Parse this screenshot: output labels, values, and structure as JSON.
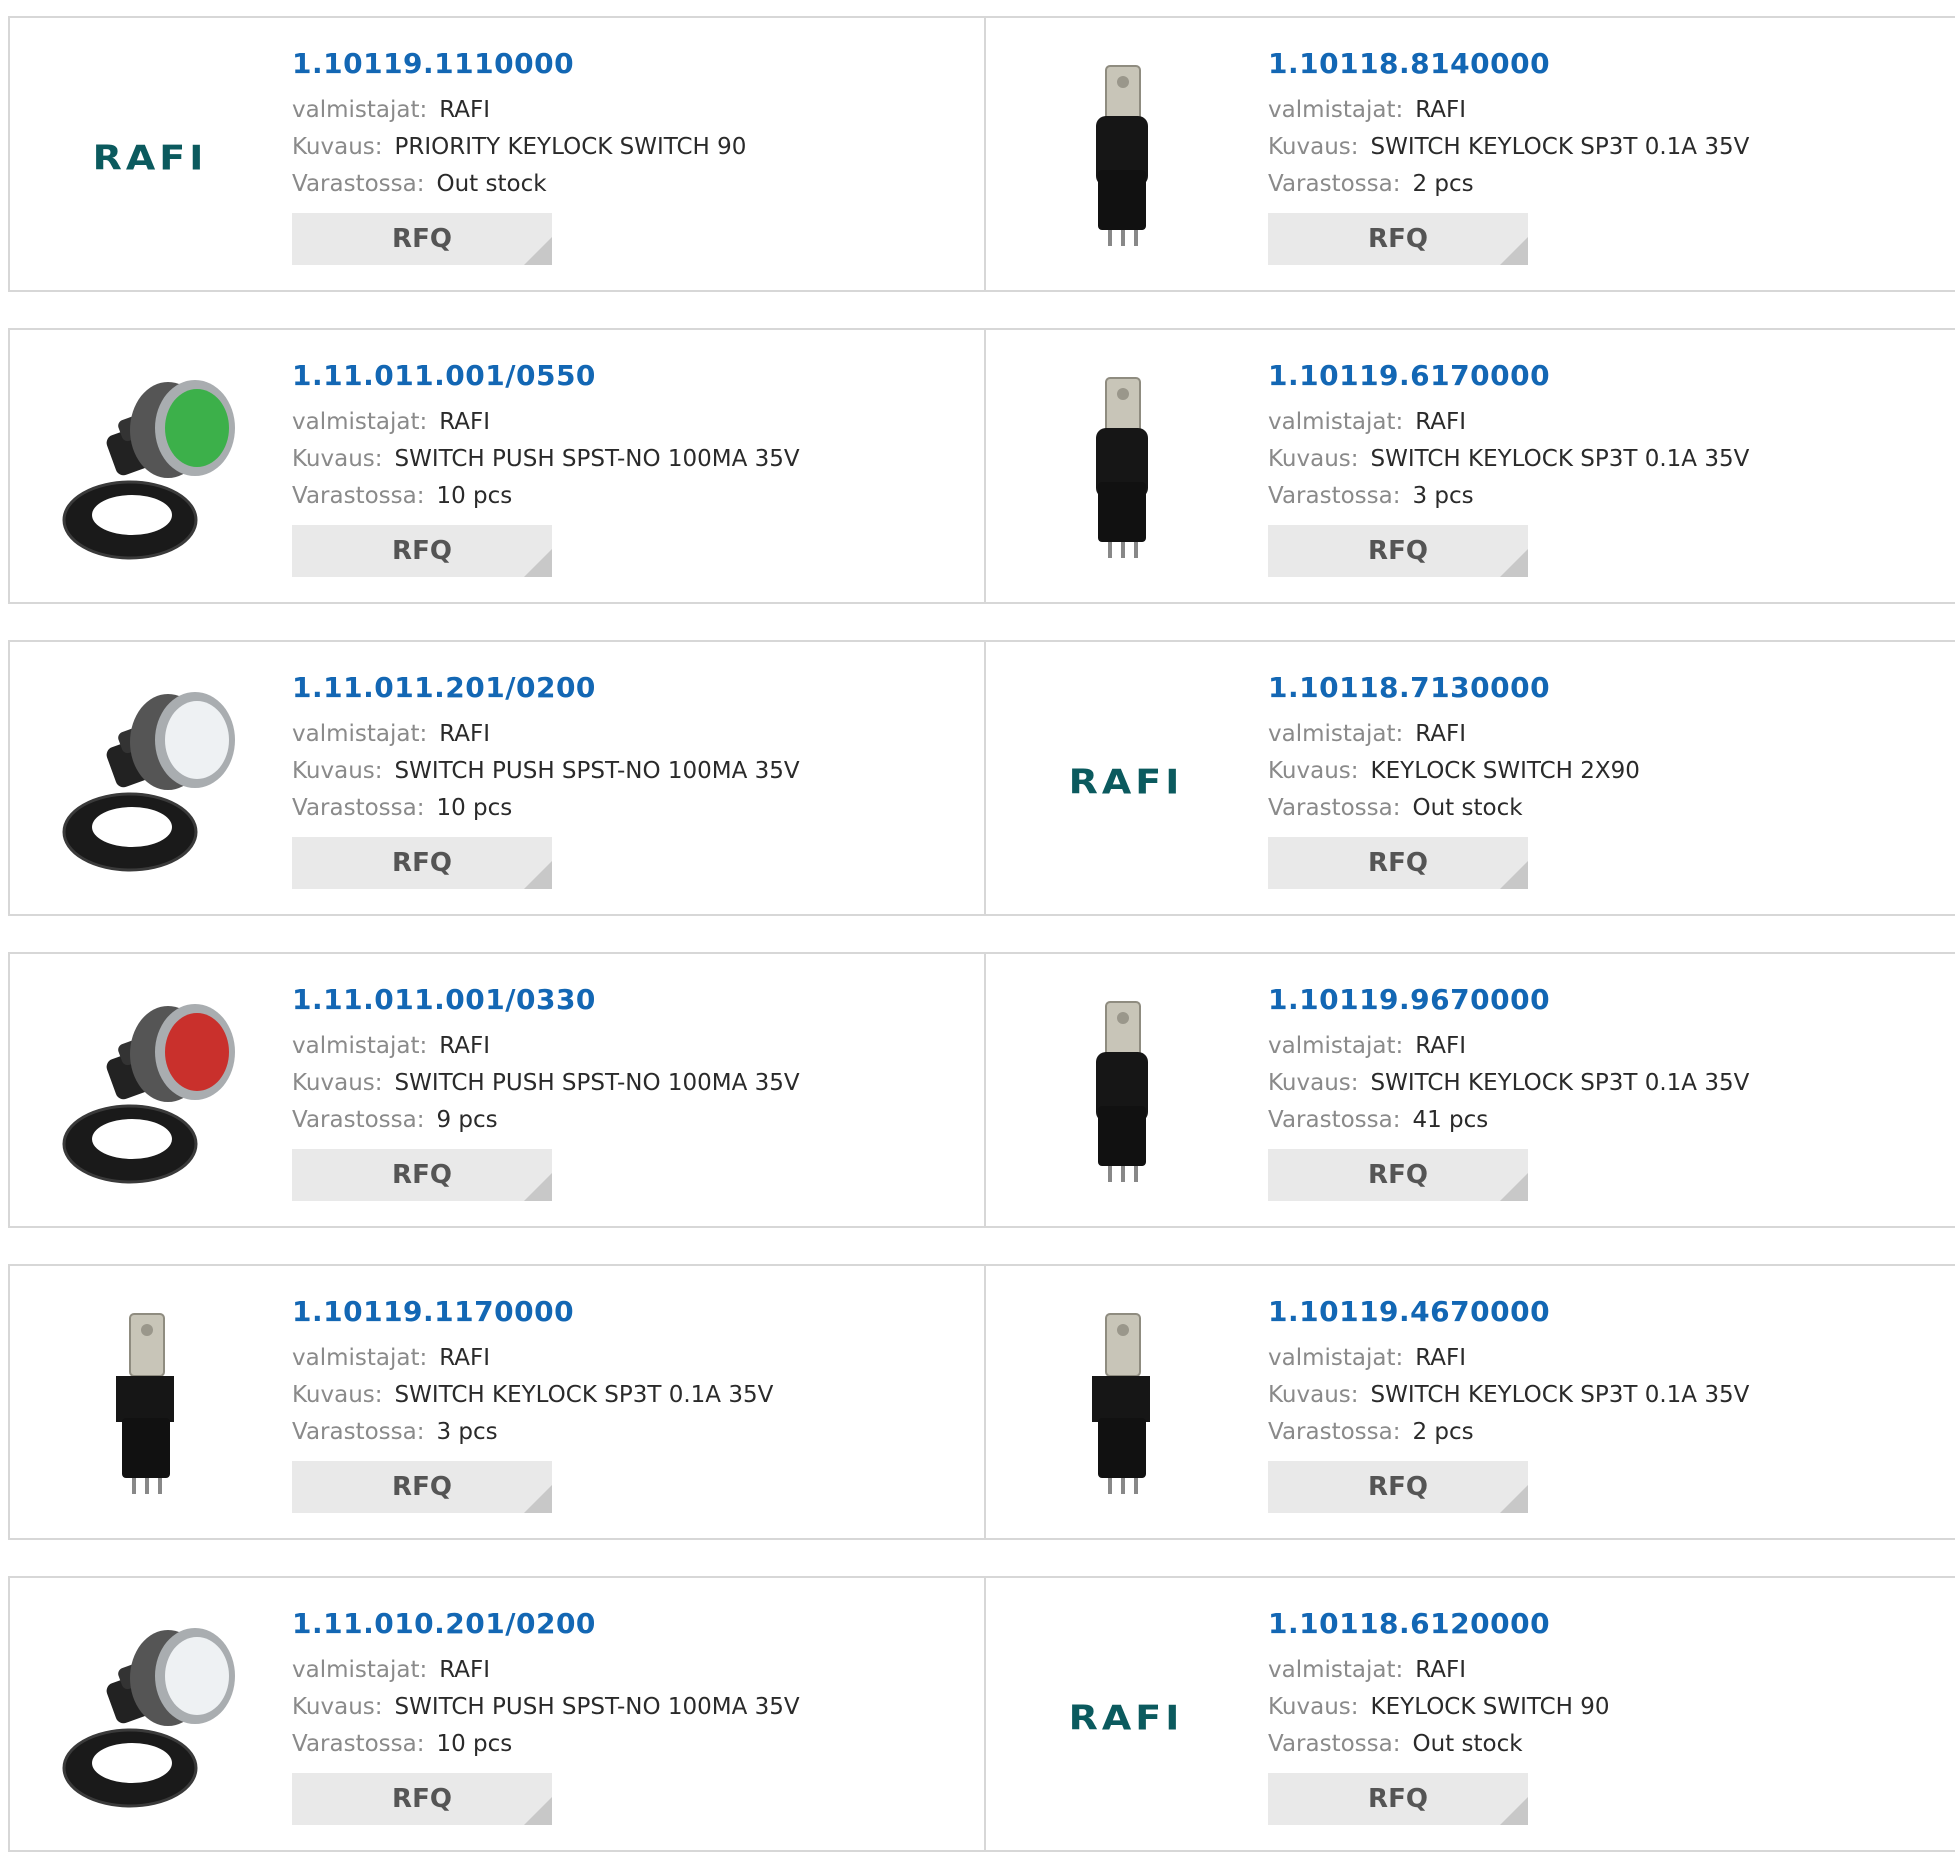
{
  "labels": {
    "manufacturer": "valmistajat:",
    "description": "Kuvaus:",
    "stock": "Varastossa:",
    "rfq": "RFQ"
  },
  "brand_logo_text": "RAFI",
  "colors": {
    "part_number": "#1367b4",
    "rafi_logo": "#0b5a5e",
    "green_button": "#3cb04a",
    "red_button": "#c9302c",
    "white_button": "#eef1f3"
  },
  "products": [
    {
      "part_number": "1.10119.1110000",
      "manufacturer": "RAFI",
      "description": "PRIORITY KEYLOCK SWITCH 90",
      "stock": "Out stock",
      "image": "rafi-logo"
    },
    {
      "part_number": "1.10118.8140000",
      "manufacturer": "RAFI",
      "description": "SWITCH KEYLOCK SP3T 0.1A 35V",
      "stock": "2 pcs",
      "image": "keylock-round"
    },
    {
      "part_number": "1.11.011.001/0550",
      "manufacturer": "RAFI",
      "description": "SWITCH PUSH SPST-NO 100MA 35V",
      "stock": "10 pcs",
      "image": "pushbutton-green"
    },
    {
      "part_number": "1.10119.6170000",
      "manufacturer": "RAFI",
      "description": "SWITCH KEYLOCK SP3T 0.1A 35V",
      "stock": "3 pcs",
      "image": "keylock-round"
    },
    {
      "part_number": "1.11.011.201/0200",
      "manufacturer": "RAFI",
      "description": "SWITCH PUSH SPST-NO 100MA 35V",
      "stock": "10 pcs",
      "image": "pushbutton-white"
    },
    {
      "part_number": "1.10118.7130000",
      "manufacturer": "RAFI",
      "description": "KEYLOCK SWITCH 2X90",
      "stock": "Out stock",
      "image": "rafi-logo"
    },
    {
      "part_number": "1.11.011.001/0330",
      "manufacturer": "RAFI",
      "description": "SWITCH PUSH SPST-NO 100MA 35V",
      "stock": "9 pcs",
      "image": "pushbutton-red"
    },
    {
      "part_number": "1.10119.9670000",
      "manufacturer": "RAFI",
      "description": "SWITCH KEYLOCK SP3T 0.1A 35V",
      "stock": "41 pcs",
      "image": "keylock-round"
    },
    {
      "part_number": "1.10119.1170000",
      "manufacturer": "RAFI",
      "description": "SWITCH KEYLOCK SP3T 0.1A 35V",
      "stock": "3 pcs",
      "image": "keylock-square"
    },
    {
      "part_number": "1.10119.4670000",
      "manufacturer": "RAFI",
      "description": "SWITCH KEYLOCK SP3T 0.1A 35V",
      "stock": "2 pcs",
      "image": "keylock-square"
    },
    {
      "part_number": "1.11.010.201/0200",
      "manufacturer": "RAFI",
      "description": "SWITCH PUSH SPST-NO 100MA 35V",
      "stock": "10 pcs",
      "image": "pushbutton-white"
    },
    {
      "part_number": "1.10118.6120000",
      "manufacturer": "RAFI",
      "description": "KEYLOCK SWITCH 90",
      "stock": "Out stock",
      "image": "rafi-logo"
    }
  ]
}
